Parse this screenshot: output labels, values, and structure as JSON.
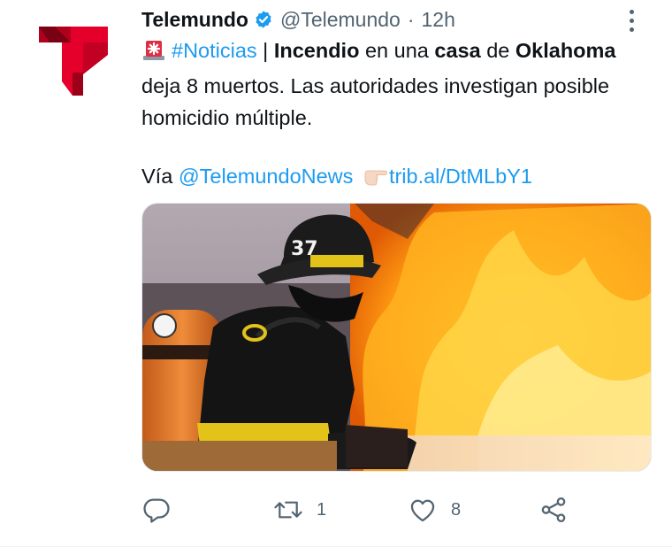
{
  "tweet": {
    "author_name": "Telemundo",
    "handle": "@Telemundo",
    "separator": "·",
    "time": "12h",
    "text": {
      "hashtag": "#Noticias",
      "pipe": " | ",
      "w1": "Incendio",
      "w2": " en una ",
      "w3": "casa",
      "w4": " de ",
      "w5": "Oklahoma",
      "w6": " deja 8 muertos. Las autoridades investigan posible homicidio múltiple."
    },
    "via": {
      "label": "Vía ",
      "mention": "@TelemundoNews",
      "link": "trib.al/DtMLbY1"
    }
  },
  "actions": {
    "reply_count": "",
    "retweet_count": "1",
    "like_count": "8"
  },
  "colors": {
    "accent": "#1d9bf0",
    "muted": "#536471",
    "brand_red": "#e4002b"
  },
  "icons": [
    "telemundo-logo",
    "verified-badge-icon",
    "more-options-icon",
    "rotating-light-icon",
    "pointing-right-icon",
    "reply-icon",
    "retweet-icon",
    "like-icon",
    "share-icon"
  ]
}
